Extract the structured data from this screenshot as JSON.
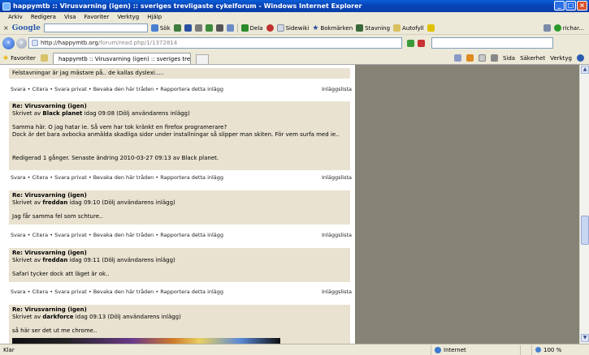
{
  "window": {
    "title": "happymtb :: Virusvarning (igen) :: sveriges trevligaste cykelforum - Windows Internet Explorer"
  },
  "menu": [
    "Arkiv",
    "Redigera",
    "Visa",
    "Favoriter",
    "Verktyg",
    "Hjälp"
  ],
  "google_toolbar": {
    "logo": "Google",
    "search_label": "Sök",
    "dela": "Dela",
    "sidewiki": "Sidewiki",
    "bokmarken": "Bokmärken",
    "stavning": "Stavning",
    "autofyll": "Autofyll",
    "user": "richar..."
  },
  "address": {
    "host": "http://happymtb.org",
    "path": "/forum/read.php/1/1372814"
  },
  "tabs": {
    "favorites": "Favoriter",
    "active_tab": "happymtb :: Virusvarning (igen) :: sveriges trevligast..."
  },
  "command_bar": [
    "Sida",
    "Säkerhet",
    "Verktyg"
  ],
  "forum": {
    "top_text": "Felstavningar är jag mästare på.. de kallas dyslexi.....",
    "action_links": "Svara • Citera • Svara privat • Bevaka den här tråden • Rapportera detta inlägg",
    "list_label": "Inläggslista",
    "posts": [
      {
        "subject": "Re: Virusvarning (igen)",
        "by_prefix": "Skrivet av",
        "author": "Black planet",
        "when": "idag 09:08 (Dölj användarens inlägg)",
        "line1": "Samma här. O jag hatar ie. Så vem har tok kränkt en firefox programerare?",
        "line2": "Dock är det bara avbocka anmälda skadliga sidor under installningar så slipper man skiten. För vem surfa med ie..",
        "edit": "Redigerad 1 gånger. Senaste ändring 2010-03-27 09:13 av Black planet."
      },
      {
        "subject": "Re: Virusvarning (igen)",
        "by_prefix": "Skrivet av",
        "author": "freddan",
        "when": "idag 09:10 (Dölj användarens inlägg)",
        "line1": "Jag får samma fel som schture.."
      },
      {
        "subject": "Re: Virusvarning (igen)",
        "by_prefix": "Skrivet av",
        "author": "freddan",
        "when": "idag 09:11 (Dölj användarens inlägg)",
        "line1": "Safari tycker dock att läget är ok.."
      },
      {
        "subject": "Re: Virusvarning (igen)",
        "by_prefix": "Skrivet av",
        "author": "darkforce",
        "when": "idag 09:13 (Dölj användarens inlägg)",
        "line1": "så här ser det ut me chrome.."
      }
    ]
  },
  "status": {
    "left": "Klar",
    "zone": "Internet",
    "zoom": "100 %"
  }
}
